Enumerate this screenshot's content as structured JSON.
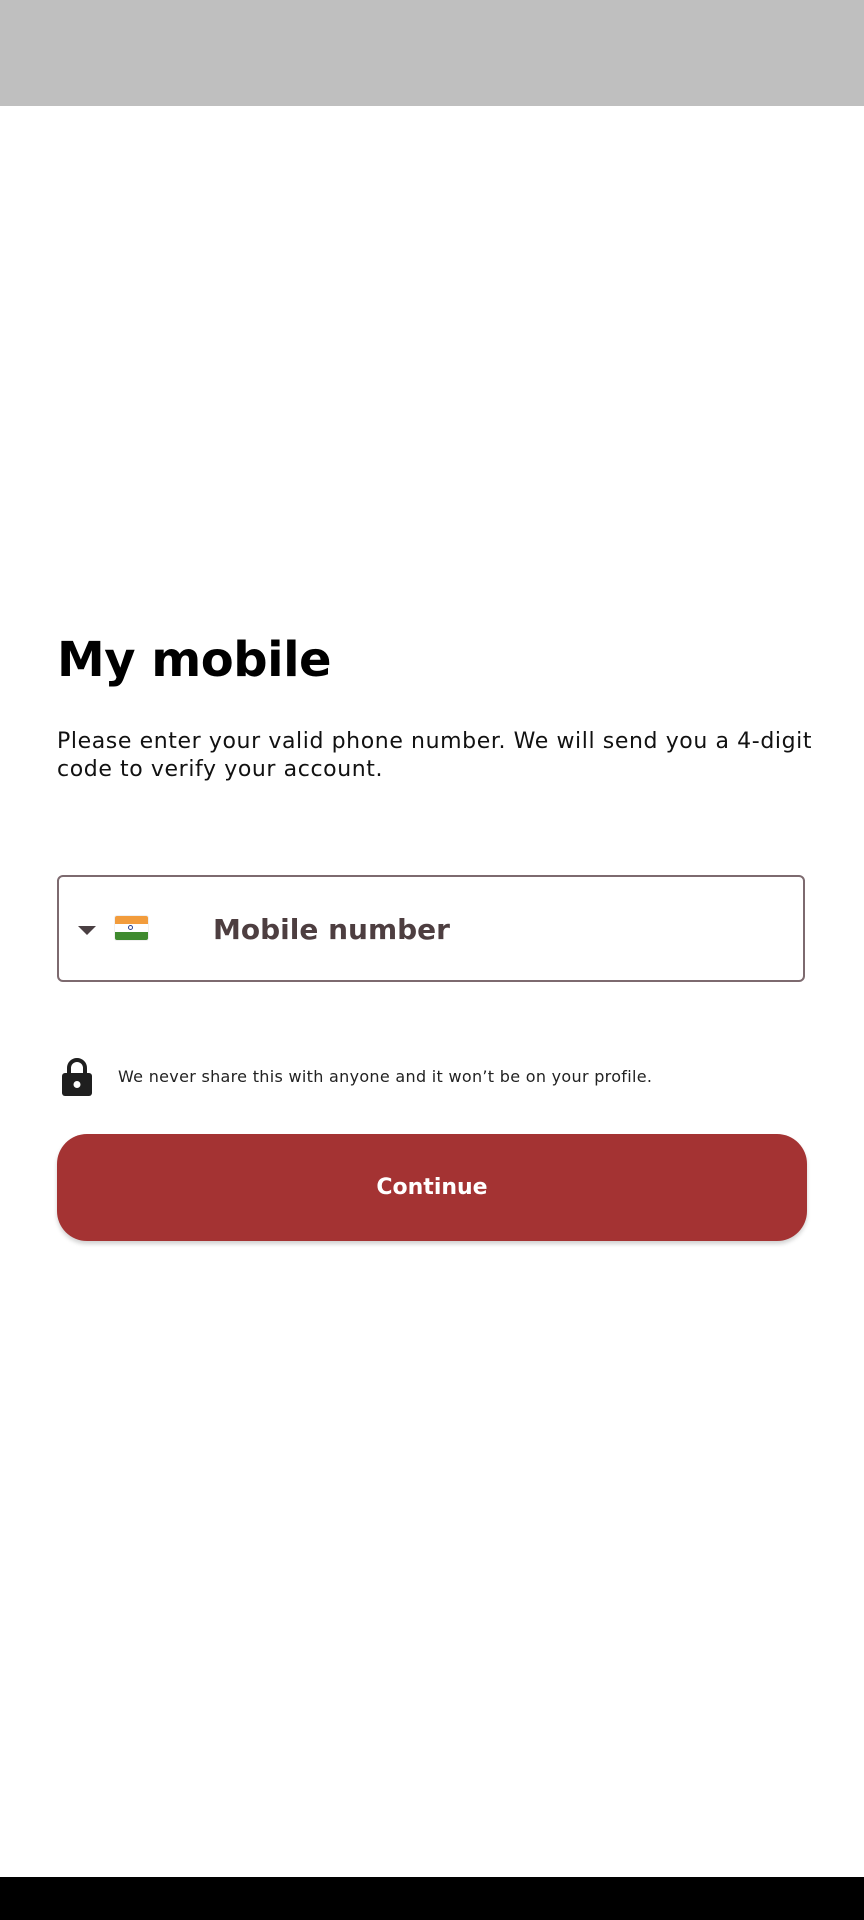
{
  "screen": {
    "title": "My mobile",
    "subtitle": "Please enter your valid phone number. We will send you a 4-digit code to verify your account."
  },
  "phone_field": {
    "country_flag": "india-flag-icon",
    "dropdown_icon": "caret-down-icon",
    "value": "",
    "placeholder": "Mobile number"
  },
  "privacy": {
    "icon": "lock-icon",
    "text": "We never share this with anyone and it won’t be on your profile."
  },
  "continue_button": {
    "label": "Continue"
  },
  "colors": {
    "primary": "#a43333",
    "field_border": "#7d6a6f",
    "placeholder_text": "#4d3e40",
    "status_bar": "#bfbfbf",
    "nav_bar": "#000000"
  }
}
